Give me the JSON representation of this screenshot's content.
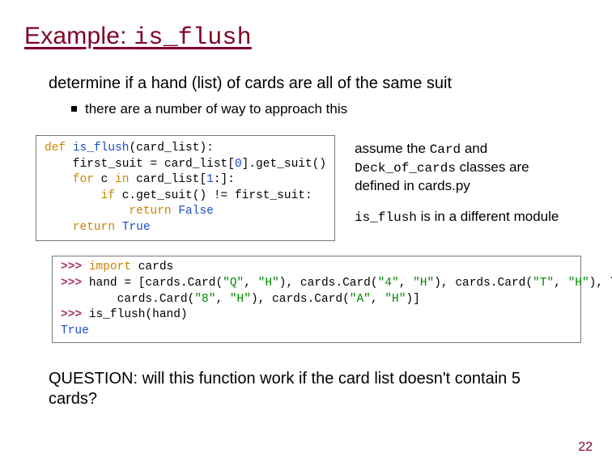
{
  "title": {
    "prefix": "Example:",
    "code": "is_flush"
  },
  "subtitle": "determine if a hand (list) of cards are all of the same suit",
  "bullet": "there are a number of way to approach this",
  "code1": {
    "l1a": "def",
    "l1b": " ",
    "l1c": "is_flush",
    "l1d": "(card_list):",
    "l2": "    first_suit = card_list[",
    "l2n": "0",
    "l2b": "].get_suit()",
    "l3a": "    ",
    "l3b": "for",
    "l3c": " c ",
    "l3d": "in",
    "l3e": " card_list[",
    "l3n": "1",
    "l3f": ":]:",
    "l4a": "        ",
    "l4b": "if",
    "l4c": " c.get_suit() != first_suit:",
    "l5a": "            ",
    "l5b": "return",
    "l5c": " ",
    "l5d": "False",
    "l6a": "    ",
    "l6b": "return",
    "l6c": " ",
    "l6d": "True"
  },
  "notes": {
    "n1a": "assume the ",
    "n1b": "Card",
    "n1c": " and",
    "n2a": "Deck_of_cards",
    "n2b": " classes are",
    "n3": "defined in cards.py",
    "n4a": "is_flush",
    "n4b": " is in a different module"
  },
  "code2": {
    "p": ">>> ",
    "l1a": "import",
    "l1b": " cards",
    "l2a": "hand = [cards.Card(",
    "s1": "\"Q\"",
    "c": ", ",
    "s2": "\"H\"",
    "l2b": "), cards.Card(",
    "s3": "\"4\"",
    "s4": "\"H\"",
    "l2c": "), cards.Card(",
    "s5": "\"T\"",
    "s6": "\"H\"",
    "l2d": "), \\",
    "l3a": "        cards.Card(",
    "s7": "\"8\"",
    "s8": "\"H\"",
    "l3b": "), cards.Card(",
    "s9": "\"A\"",
    "s10": "\"H\"",
    "l3c": ")]",
    "l4": "is_flush(hand)",
    "l5": "True"
  },
  "question": "QUESTION: will this function work if the card list doesn't contain 5 cards?",
  "pagenum": "22"
}
